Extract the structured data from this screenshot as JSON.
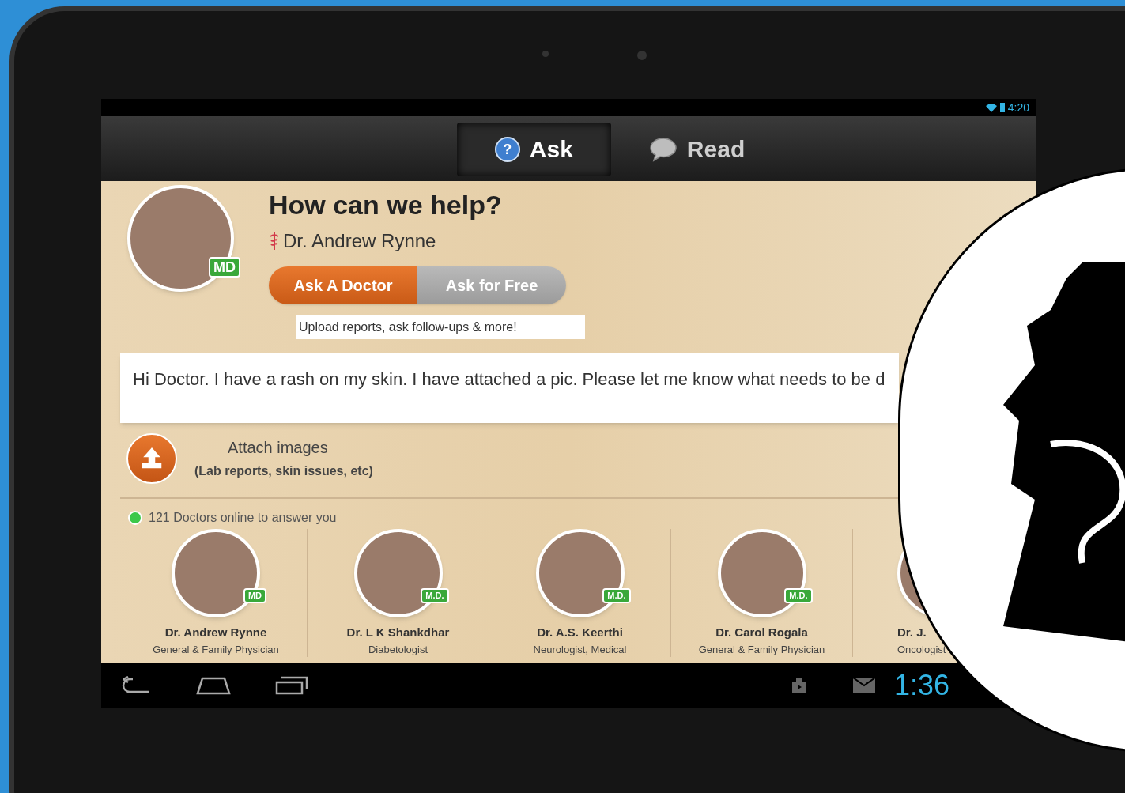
{
  "status_bar": {
    "time": "4:20"
  },
  "tabs": [
    {
      "label": "Ask",
      "icon_char": "?",
      "selected": true
    },
    {
      "label": "Read",
      "selected": false
    }
  ],
  "header": {
    "title": "How can we help?",
    "doctor_name": "Dr. Andrew Rynne",
    "badge": "MD"
  },
  "mode_toggle": [
    {
      "label": "Ask A Doctor",
      "selected": true
    },
    {
      "label": "Ask for Free",
      "selected": false
    }
  ],
  "tooltip": "Upload reports, ask follow-ups & more!",
  "message": "Hi Doctor. I have a rash on my skin. I have attached a pic. Please let me know what needs to be d",
  "attach": {
    "label": "Attach images",
    "hint": "(Lab reports, skin issues, etc)"
  },
  "online": {
    "text": "121 Doctors online to answer you",
    "color": "#3cc84a"
  },
  "doctors": [
    {
      "name": "Dr. Andrew Rynne",
      "specialty": "General & Family Physician",
      "badge": "MD"
    },
    {
      "name": "Dr. L K Shankdhar",
      "specialty": "Diabetologist",
      "badge": "M.D."
    },
    {
      "name": "Dr. A.S. Keerthi",
      "specialty": "Neurologist, Medical",
      "badge": "M.D."
    },
    {
      "name": "Dr. Carol Rogala",
      "specialty": "General & Family Physician",
      "badge": "M.D."
    },
    {
      "name": "Dr. J.",
      "specialty": "Oncologist"
    }
  ],
  "nav_bar": {
    "time": "1:36"
  }
}
